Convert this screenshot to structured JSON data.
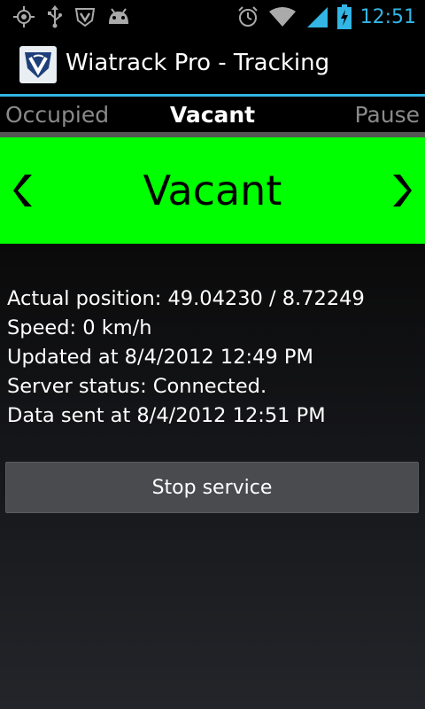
{
  "status_bar": {
    "time": "12:51",
    "left_icons": [
      "gps-icon",
      "usb-icon",
      "wiatrack-notification-icon",
      "android-debug-icon"
    ],
    "right_icons": [
      "alarm-icon",
      "wifi-icon",
      "signal-icon",
      "battery-charging-icon"
    ],
    "accent_color": "#33b5e5"
  },
  "action_bar": {
    "title": "Wiatrack Pro - Tracking",
    "icon": "wiatrack-app-icon"
  },
  "mode_tabs": {
    "items": [
      {
        "label": "Occupied",
        "active": false
      },
      {
        "label": "Vacant",
        "active": true
      },
      {
        "label": "Pause",
        "active": false
      }
    ]
  },
  "status_banner": {
    "label": "Vacant",
    "background_color": "#00ff00",
    "prev_icon": "chevron-left-icon",
    "next_icon": "chevron-right-icon"
  },
  "info": {
    "lines": [
      "Actual position: 49.04230 / 8.72249",
      "Speed: 0 km/h",
      "Updated at 8/4/2012 12:49 PM",
      "Server status: Connected.",
      "Data sent at 8/4/2012 12:51 PM"
    ]
  },
  "stop_button": {
    "label": "Stop service"
  }
}
